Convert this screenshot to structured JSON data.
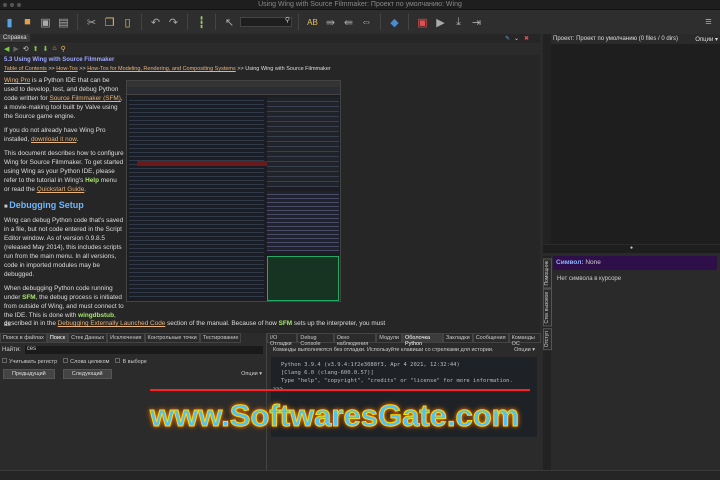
{
  "window": {
    "title": "Using Wing with Source Filmmaker: Проект по умолчанию: Wing"
  },
  "toolbar": {
    "icons": [
      "new-file",
      "open-folder",
      "save",
      "save-all",
      "cut",
      "copy",
      "paste",
      "undo",
      "redo",
      "indent",
      "find-pointer",
      "search",
      "spellcheck",
      "indent-right",
      "indent-left",
      "swap",
      "python",
      "debug",
      "run",
      "step-into",
      "step-out",
      "menu"
    ]
  },
  "help": {
    "tab": "Справка",
    "heading": "5.3 Using Wing with Source Filmmaker",
    "breadcrumb": [
      "Table of Contents",
      "How-Tos",
      "How-Tos for Modeling, Rendering, and Compositing Systems",
      "Using Wing with Source Filmmaker"
    ],
    "sep": " >> ",
    "p1": {
      "a": "Wing Pro",
      "b": " is a Python IDE that can be used to develop, test, and debug Python code written for ",
      "c": "Source Filmmaker (SFM)",
      "d": ", a movie-making tool built by Valve using the Source game engine."
    },
    "p2": {
      "a": "If you do not already have Wing Pro installed, ",
      "b": "download it now",
      "c": "."
    },
    "p3": {
      "a": "This document describes how to configure Wing for Source Filmmaker. To get started using Wing as your Python IDE, please refer to the tutorial in Wing's ",
      "b": "Help",
      "c": " menu or read the ",
      "d": "Quickstart Guide",
      "e": "."
    },
    "h2": "Debugging Setup",
    "p4": "Wing can debug Python code that's saved in a file, but not code entered in the Script Editor window. As of version 0.9.8.5 (released May 2014), this includes scripts run from the main menu. In all versions, code in imported modules may be debugged.",
    "p5": {
      "a": "When debugging Python code running under ",
      "b": "SFM",
      "c": ", the debug process is initiated from outside of Wing, and must connect to the IDE. This is done with ",
      "d": "wingdbstub",
      "e": ", as"
    },
    "p6": {
      "a": "described in in the ",
      "b": "Debugging Externally Launched Code",
      "c": " section of the manual. Because of how ",
      "d": "SFM",
      "e": " sets up the interpreter, you must"
    }
  },
  "project": {
    "title": "Проект: Проект по умолчанию (0 files / 0 dirs)",
    "options": "Опции ▾"
  },
  "symbol": {
    "label": "Символ:",
    "value": "None",
    "empty": "Нет символа в курсоре",
    "vtabs": [
      "Помощник",
      "Стек вызовов",
      "Отступ"
    ]
  },
  "search": {
    "tabs": [
      "Поиск в файлах",
      "Поиск",
      "Стек Данных",
      "Исключения",
      "Контрольные точки",
      "Тестирование"
    ],
    "active": 1,
    "find_label": "Найти:",
    "find_value": "ces",
    "checks": [
      "Учитывать регистр",
      "Слова целиком",
      "В выборе"
    ],
    "prev": "Предыдущий",
    "next": "Следующий",
    "options": "Опции ▾"
  },
  "shell": {
    "tabs": [
      "I/O Отладки",
      "Debug Console",
      "Окно наблюдения",
      "Модули",
      "Оболочка Python",
      "Закладки",
      "Сообщения",
      "Команды ОС"
    ],
    "active": 4,
    "hint": "Команды выполняются без отладки.  Используйте клавиши со стрелками для истории.",
    "options": "Опции ▾",
    "lines": [
      "Python 3.9.4 (v3.9.4:1f2e3088f3, Apr  4 2021, 12:32:44)",
      "[Clang 6.0 (clang-600.0.57)]",
      "Type \"help\", \"copyright\", \"credits\" or \"license\" for more information."
    ],
    "prompt": ">>>"
  },
  "watermark": "www.SoftwaresGate.com"
}
